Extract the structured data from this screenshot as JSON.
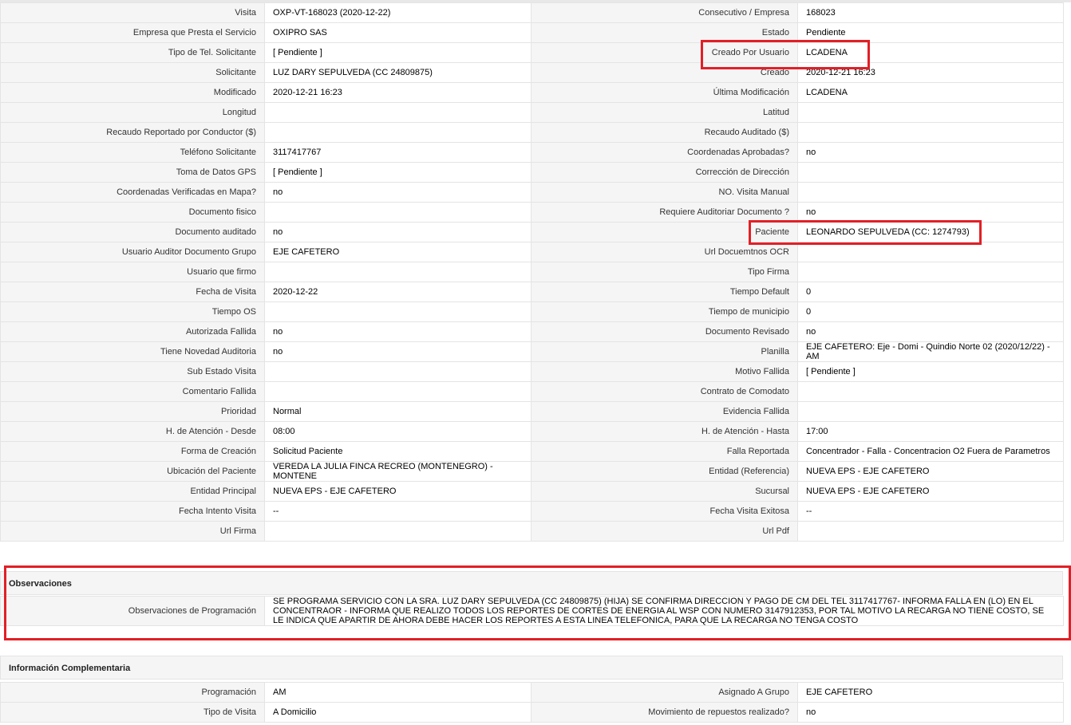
{
  "main_rows": [
    {
      "l1": "Visita",
      "v1": "OXP-VT-168023 (2020-12-22)",
      "l2": "Consecutivo / Empresa",
      "v2": "168023"
    },
    {
      "l1": "Empresa que Presta el Servicio",
      "v1": "OXIPRO SAS",
      "l2": "Estado",
      "v2": "Pendiente"
    },
    {
      "l1": "Tipo de Tel. Solicitante",
      "v1": "[ Pendiente ]",
      "l2": "Creado Por Usuario",
      "v2": "LCADENA"
    },
    {
      "l1": "Solicitante",
      "v1": "LUZ DARY SEPULVEDA (CC 24809875)",
      "l2": "Creado",
      "v2": "2020-12-21 16:23"
    },
    {
      "l1": "Modificado",
      "v1": "2020-12-21 16:23",
      "l2": "Última Modificación",
      "v2": " LCADENA"
    },
    {
      "l1": "Longitud",
      "v1": "",
      "l2": "Latitud",
      "v2": ""
    },
    {
      "l1": "Recaudo Reportado por Conductor ($)",
      "v1": "",
      "l2": "Recaudo Auditado ($)",
      "v2": ""
    },
    {
      "l1": "Teléfono Solicitante",
      "v1": "3117417767",
      "l2": "Coordenadas Aprobadas?",
      "v2": " no"
    },
    {
      "l1": "Toma de Datos GPS",
      "v1": "[ Pendiente ]",
      "l2": "Corrección de Dirección",
      "v2": ""
    },
    {
      "l1": "Coordenadas Verificadas en Mapa?",
      "v1": " no",
      "l2": "NO. Visita Manual",
      "v2": ""
    },
    {
      "l1": "Documento fisico",
      "v1": "",
      "l2": "Requiere Auditoriar Documento ?",
      "v2": " no"
    },
    {
      "l1": "Documento auditado",
      "v1": " no",
      "l2": "Paciente",
      "v2": "LEONARDO SEPULVEDA (CC: 1274793)"
    },
    {
      "l1": "Usuario Auditor Documento Grupo",
      "v1": "EJE CAFETERO",
      "l2": "Url Docuemtnos OCR",
      "v2": ""
    },
    {
      "l1": "Usuario que firmo",
      "v1": "",
      "l2": "Tipo Firma",
      "v2": ""
    },
    {
      "l1": "Fecha de Visita",
      "v1": " 2020-12-22",
      "l2": "Tiempo Default",
      "v2": "0"
    },
    {
      "l1": "Tiempo OS",
      "v1": "",
      "l2": "Tiempo de municipio",
      "v2": "0"
    },
    {
      "l1": "Autorizada Fallida",
      "v1": " no",
      "l2": "Documento Revisado",
      "v2": " no"
    },
    {
      "l1": "Tiene Novedad Auditoria",
      "v1": " no",
      "l2": "Planilla",
      "v2": "EJE CAFETERO: Eje - Domi - Quindio Norte 02 (2020/12/22) - AM"
    },
    {
      "l1": "Sub Estado Visita",
      "v1": "",
      "l2": "Motivo Fallida",
      "v2": "[ Pendiente ]"
    },
    {
      "l1": "Comentario Fallida",
      "v1": "",
      "l2": "Contrato de Comodato",
      "v2": ""
    },
    {
      "l1": "Prioridad",
      "v1": "Normal",
      "l2": "Evidencia Fallida",
      "v2": ""
    },
    {
      "l1": "H. de Atención - Desde",
      "v1": "08:00",
      "l2": "H. de Atención - Hasta",
      "v2": "17:00"
    },
    {
      "l1": "Forma de Creación",
      "v1": "Solicitud Paciente",
      "l2": "Falla Reportada",
      "v2": "Concentrador - Falla - Concentracion O2 Fuera de Parametros"
    },
    {
      "l1": "Ubicación del Paciente",
      "v1": "VEREDA LA JULIA FINCA RECREO (MONTENEGRO) - MONTENE",
      "l2": "Entidad (Referencia)",
      "v2": "NUEVA EPS - EJE CAFETERO"
    },
    {
      "l1": "Entidad Principal",
      "v1": "NUEVA EPS - EJE CAFETERO",
      "l2": "Sucursal",
      "v2": "NUEVA EPS - EJE CAFETERO"
    },
    {
      "l1": "Fecha Intento Visita",
      "v1": " --",
      "l2": "Fecha Visita Exitosa",
      "v2": " --"
    },
    {
      "l1": "Url Firma",
      "v1": "",
      "l2": "Url Pdf",
      "v2": ""
    }
  ],
  "observaciones": {
    "title": "Observaciones",
    "label": "Observaciones de Programación",
    "text": "  SE PROGRAMA SERVICIO CON LA SRA. LUZ DARY SEPULVEDA (CC 24809875) (HIJA) SE CONFIRMA DIRECCION Y PAGO DE CM DEL TEL 3117417767- INFORMA FALLA EN (LO) EN EL CONCENTRAOR - INFORMA QUE REALIZO TODOS LOS REPORTES DE CORTES DE ENERGIA AL WSP CON NUMERO 3147912353, POR TAL MOTIVO LA RECARGA NO TIENE COSTO, SE LE INDICA QUE APARTIR DE AHORA DEBE HACER LOS REPORTES A ESTA LINEA TELEFONICA, PARA QUE LA RECARGA NO TENGA COSTO"
  },
  "complementaria": {
    "title": "Información Complementaria",
    "rows": [
      {
        "l1": "Programación",
        "v1": "AM",
        "l2": "Asignado A Grupo",
        "v2": "EJE CAFETERO"
      },
      {
        "l1": "Tipo de Visita",
        "v1": "A Domicilio",
        "l2": "Movimiento de repuestos realizado?",
        "v2": " no"
      }
    ]
  },
  "highlight_color": "#e21f26"
}
